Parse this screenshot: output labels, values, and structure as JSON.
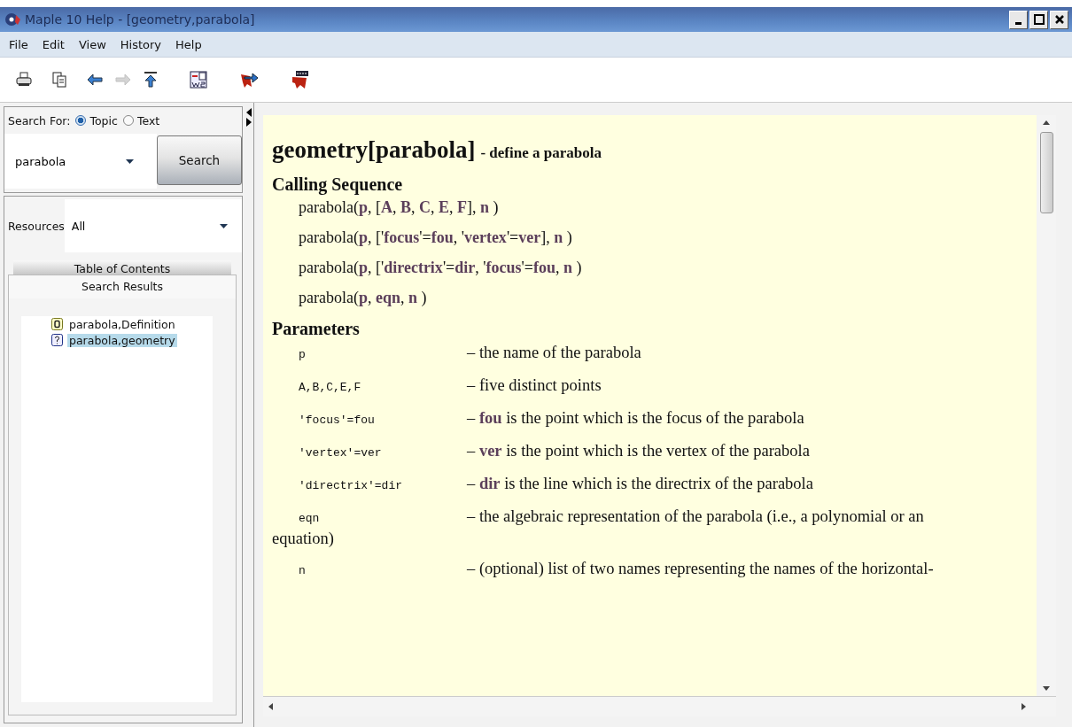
{
  "window": {
    "title": "Maple 10 Help - [geometry,parabola]"
  },
  "menu": [
    "File",
    "Edit",
    "View",
    "History",
    "Help"
  ],
  "toolbar": [
    {
      "kind": "print",
      "disabled": false
    },
    {
      "kind": "copy",
      "disabled": false
    },
    {
      "kind": "back",
      "disabled": false
    },
    {
      "kind": "forward",
      "disabled": true
    },
    {
      "kind": "top",
      "disabled": false
    },
    {
      "kind": "worksheet",
      "disabled": false
    },
    {
      "kind": "arrow",
      "disabled": false
    },
    {
      "kind": "bookmark",
      "disabled": false
    }
  ],
  "search": {
    "label": "Search For:",
    "options": [
      {
        "label": "Topic",
        "selected": true
      },
      {
        "label": "Text",
        "selected": false
      }
    ],
    "value": "parabola",
    "button": "Search"
  },
  "resources": {
    "label": "Resources",
    "value": "All"
  },
  "tabs": [
    {
      "label": "Table of Contents",
      "selected": false
    },
    {
      "label": "Search Results",
      "selected": true
    }
  ],
  "results": [
    {
      "kind": "definition",
      "label": "parabola,Definition",
      "selected": false
    },
    {
      "kind": "help",
      "label": "parabola,geometry",
      "selected": true
    }
  ],
  "document": {
    "title": "geometry[parabola]",
    "subtitle": "- define a parabola",
    "sections": [
      {
        "heading": "Calling Sequence",
        "kind": "calls",
        "lines": [
          "parabola(**p**, [**A**, **B**, **C**, **E**, **F**], **n** )",
          "parabola(**p**, ['**focus**'=**fou**, '**vertex**'=**ver**], **n** )",
          "parabola(**p**, ['**directrix**'=**dir**, '**focus**'=**fou**, **n** )",
          "parabola(**p**, **eqn**, **n** )"
        ]
      },
      {
        "heading": "Parameters",
        "kind": "params",
        "rows": [
          {
            "name": "p",
            "text": "– the name of the parabola"
          },
          {
            "name": "A,B,C,E,F",
            "text": "– five distinct points"
          },
          {
            "name": "'focus'=fou",
            "text": "– **fou** is the point which is the focus of the parabola"
          },
          {
            "name": "'vertex'=ver",
            "text": "– **ver** is the point which is the vertex of the parabola"
          },
          {
            "name": "'directrix'=dir",
            "text": "– **dir** is the line which is the directrix of the parabola"
          },
          {
            "name": "eqn",
            "text": "– the algebraic representation of the parabola (i.e., a polynomial or an equation)"
          },
          {
            "name": "n",
            "text": "– (optional) list of two names representing the names of the horizontal-"
          }
        ]
      }
    ]
  }
}
